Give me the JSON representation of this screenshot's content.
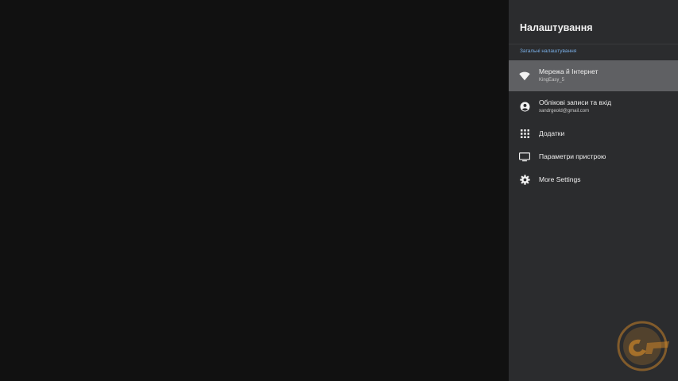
{
  "panel": {
    "title": "Налаштування",
    "section_label": "Загальні налаштування"
  },
  "menu": [
    {
      "id": "network",
      "icon": "wifi-icon",
      "title": "Мережа й Інтернет",
      "subtitle": "KingEasy_5",
      "focused": true
    },
    {
      "id": "accounts",
      "icon": "account-circle-icon",
      "title": "Облікові записи та вхід",
      "subtitle": "xandrgeold@gmail.com",
      "focused": false
    },
    {
      "id": "apps",
      "icon": "apps-grid-icon",
      "title": "Додатки",
      "subtitle": "",
      "focused": false
    },
    {
      "id": "device",
      "icon": "tv-display-icon",
      "title": "Параметри пристрою",
      "subtitle": "",
      "focused": false
    },
    {
      "id": "more",
      "icon": "gear-icon",
      "title": "More Settings",
      "subtitle": "",
      "focused": false
    }
  ],
  "colors": {
    "background": "#111111",
    "panel": "#2b2c2e",
    "focused_item": "#5f6063",
    "section_label": "#7ab0e8",
    "watermark": "#c9842a"
  },
  "watermark": {
    "icon": "site-logo-watermark"
  }
}
